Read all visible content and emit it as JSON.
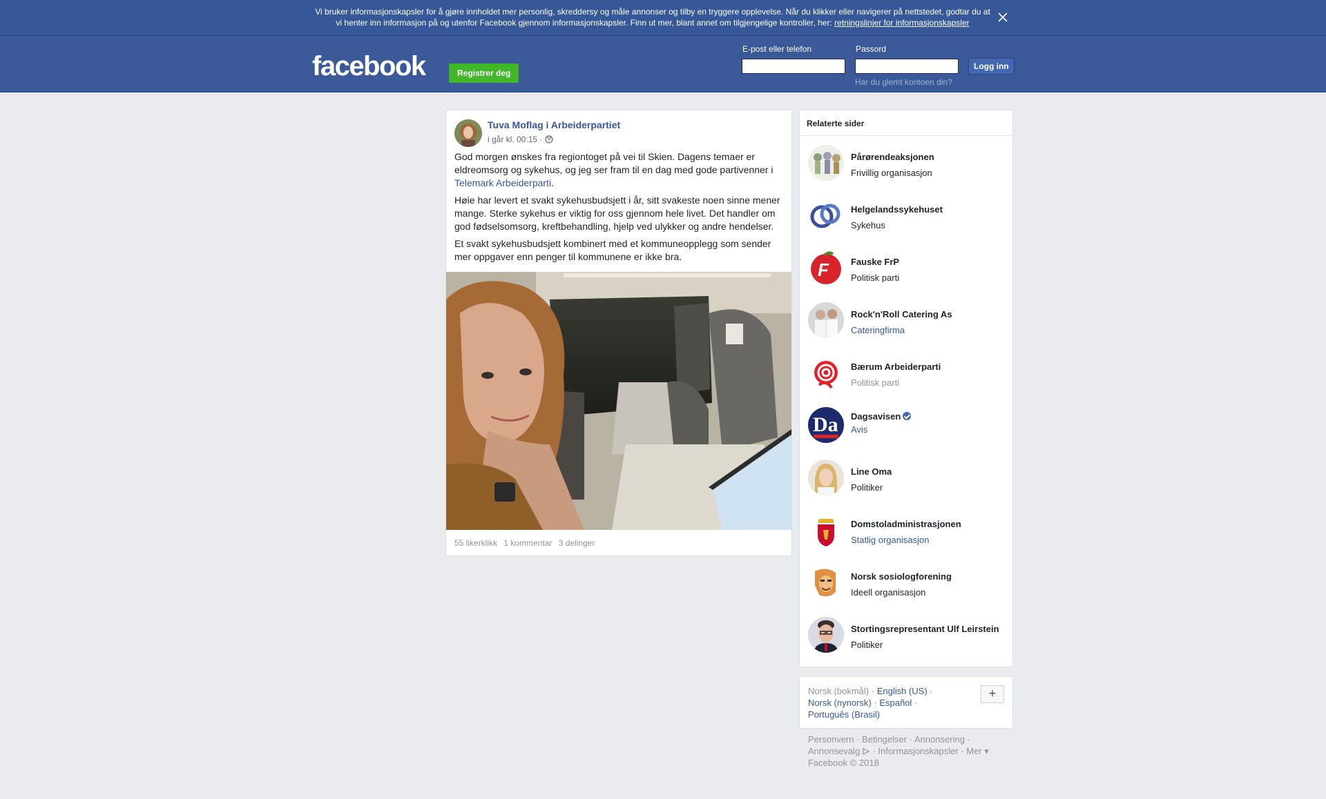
{
  "cookie_banner": {
    "text_line1": "Vi bruker informasjonskapsler for å gjøre innholdet mer personlig, skreddersy og måle annonser og tilby en tryggere opplevelse. Når du klikker eller navigerer på nettstedet, godtar du at",
    "text_line2": "vi henter inn informasjon på og utenfor Facebook gjennom informasjonskapsler. Finn ut mer, blant annet om tilgjengelige kontroller, her: ",
    "link": "retningslinjer for informasjonskapsler",
    "close_icon": "close-icon"
  },
  "header": {
    "logo": "facebook",
    "register_label": "Registrer deg",
    "email_label": "E-post eller telefon",
    "password_label": "Passord",
    "login_label": "Logg inn",
    "forgot_label": "Har du glemt kontoen din?"
  },
  "post": {
    "author": "Tuva Moflag i Arbeiderpartiet",
    "time": "i går kl. 00:15",
    "audience_icon": "globe-icon",
    "p1_before": "God morgen ønskes fra regiontoget på vei til Skien. Dagens temaer er eldreomsorg og sykehus, og jeg ser fram til en dag med gode partivenner i ",
    "p1_link": "Telemark Arbeiderparti",
    "p1_after": ".",
    "p2": "Høie har levert et svakt sykehusbudsjett i år, sitt svakeste noen sinne mener mange. Sterke sykehus er viktig for oss gjennom hele livet. Det handler om god fødselsomsorg, kreftbehandling, hjelp ved ulykker og andre hendelser.",
    "p3": "Et svakt sykehusbudsjett kombinert med et kommuneopplegg som sender mer oppgaver enn penger til kommunene er ikke bra.",
    "likes": "55 likerklikk",
    "comments": "1 kommentar",
    "shares": "3 delinger"
  },
  "related": {
    "title": "Relaterte sider",
    "items": [
      {
        "name": "Pårørendeaksjonen",
        "category": "Frivillig organisasjon"
      },
      {
        "name": "Helgelandssykehuset",
        "category": "Sykehus"
      },
      {
        "name": "Fauske FrP",
        "category": "Politisk parti"
      },
      {
        "name": "Rock'n'Roll Catering As",
        "category": "Cateringfirma"
      },
      {
        "name": "Bærum Arbeiderparti",
        "category": "Politisk parti"
      },
      {
        "name": "Dagsavisen",
        "category": "Avis"
      },
      {
        "name": "Line Oma",
        "category": "Politiker"
      },
      {
        "name": "Domstoladministrasjonen",
        "category": "Statlig organisasjon"
      },
      {
        "name": "Norsk sosiologforening",
        "category": "Ideell organisasjon"
      },
      {
        "name": "Stortingsrepresentant Ulf Leirstein",
        "category": "Politiker"
      }
    ]
  },
  "languages": {
    "current": "Norsk (bokmål)",
    "english": "English (US)",
    "nynorsk": "Norsk (nynorsk)",
    "spanish": "Español",
    "portuguese": "Português (Brasil)",
    "more": "+"
  },
  "footer": {
    "privacy": "Personvern",
    "terms": "Betingelser",
    "ads": "Annonsering",
    "adchoices": "Annonsevalg",
    "cookies": "Informasjonskapsler",
    "more": "Mer",
    "copyright": "Facebook © 2018"
  }
}
